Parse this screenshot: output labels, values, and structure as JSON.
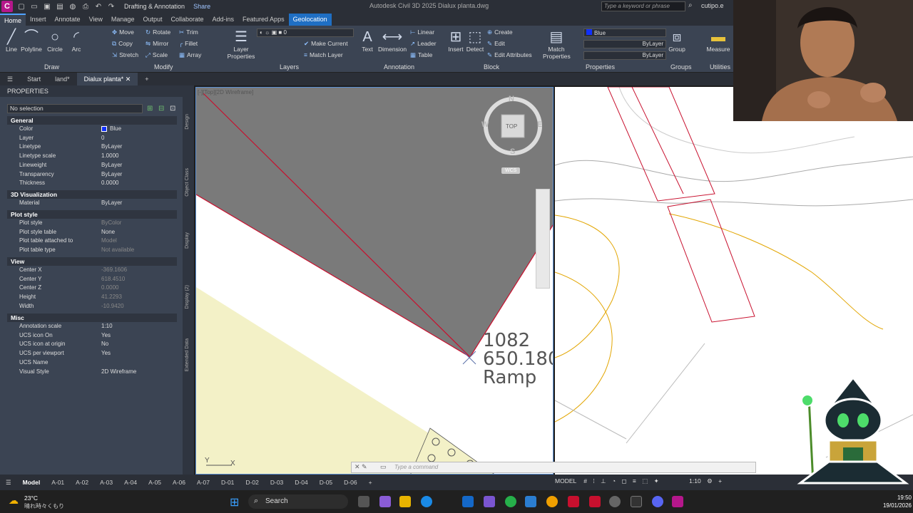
{
  "titlebar": {
    "app_letter": "C",
    "workspace": "Drafting & Annotation",
    "share": "Share",
    "title": "Autodesk Civil 3D 2025    Dialux planta.dwg",
    "search_placeholder": "Type a keyword or phrase",
    "user": "cutipo.e"
  },
  "ribbon_tabs": [
    "Home",
    "Insert",
    "Annotate",
    "View",
    "Manage",
    "Output",
    "Collaborate",
    "Add-ins",
    "Featured Apps",
    "Geolocation"
  ],
  "ribbon": {
    "draw": {
      "label": "Draw",
      "line": "Line",
      "polyline": "Polyline",
      "circle": "Circle",
      "arc": "Arc"
    },
    "modify": {
      "label": "Modify",
      "move": "Move",
      "rotate": "Rotate",
      "trim": "Trim",
      "copy": "Copy",
      "mirror": "Mirror",
      "fillet": "Fillet",
      "stretch": "Stretch",
      "scale": "Scale",
      "array": "Array"
    },
    "layers": {
      "label": "Layers",
      "layer_properties": "Layer Properties",
      "current_layer": "0",
      "make_current": "Make Current",
      "match_layer": "Match Layer"
    },
    "annotation": {
      "label": "Annotation",
      "text": "Text",
      "dimension": "Dimension",
      "linear": "Linear",
      "leader": "Leader",
      "table": "Table"
    },
    "block": {
      "label": "Block",
      "insert": "Insert",
      "detect": "Detect",
      "create": "Create",
      "edit": "Edit",
      "edit_attributes": "Edit Attributes"
    },
    "properties": {
      "label": "Properties",
      "match": "Match Properties",
      "color": "Blue",
      "linetype": "ByLayer",
      "lineweight": "ByLayer"
    },
    "groups": {
      "label": "Groups",
      "group": "Group"
    },
    "utilities": {
      "label": "Utilities",
      "measure": "Measure"
    }
  },
  "file_tabs": [
    "Start",
    "land*",
    "Dialux planta*"
  ],
  "properties_panel": {
    "title": "PROPERTIES",
    "selection": "No selection",
    "sections": {
      "general": "General",
      "viz3d": "3D Visualization",
      "plot": "Plot style",
      "view": "View",
      "misc": "Misc"
    },
    "general": [
      {
        "k": "Color",
        "v": "Blue"
      },
      {
        "k": "Layer",
        "v": "0"
      },
      {
        "k": "Linetype",
        "v": "ByLayer"
      },
      {
        "k": "Linetype scale",
        "v": "1.0000"
      },
      {
        "k": "Lineweight",
        "v": "ByLayer"
      },
      {
        "k": "Transparency",
        "v": "ByLayer"
      },
      {
        "k": "Thickness",
        "v": "0.0000"
      }
    ],
    "viz3d": [
      {
        "k": "Material",
        "v": "ByLayer"
      }
    ],
    "plot": [
      {
        "k": "Plot style",
        "v": "ByColor"
      },
      {
        "k": "Plot style table",
        "v": "None"
      },
      {
        "k": "Plot table attached to",
        "v": "Model"
      },
      {
        "k": "Plot table type",
        "v": "Not available"
      }
    ],
    "view": [
      {
        "k": "Center X",
        "v": "-369.1606"
      },
      {
        "k": "Center Y",
        "v": "618.4510"
      },
      {
        "k": "Center Z",
        "v": "0.0000"
      },
      {
        "k": "Height",
        "v": "41.2293"
      },
      {
        "k": "Width",
        "v": "-10.9420"
      }
    ],
    "misc": [
      {
        "k": "Annotation scale",
        "v": "1:10"
      },
      {
        "k": "UCS icon On",
        "v": "Yes"
      },
      {
        "k": "UCS icon at origin",
        "v": "No"
      },
      {
        "k": "UCS per viewport",
        "v": "Yes"
      },
      {
        "k": "UCS Name",
        "v": ""
      },
      {
        "k": "Visual Style",
        "v": "2D Wireframe"
      }
    ],
    "side_tabs": [
      "Design",
      "Object Class",
      "Display",
      "Display (2)",
      "Extended Data"
    ]
  },
  "viewport": {
    "label": "[-][Top][2D Wireframe]",
    "viewcube": {
      "top": "TOP",
      "n": "N",
      "s": "S",
      "e": "E",
      "w": "W",
      "wcs": "WCS"
    },
    "text1": "1082",
    "text2": "650.180",
    "text3": "Ramp",
    "ucs_y": "Y",
    "ucs_x": "X"
  },
  "command": {
    "placeholder": "Type a command"
  },
  "layout_tabs": [
    "Model",
    "A-01",
    "A-02",
    "A-03",
    "A-04",
    "A-05",
    "A-06",
    "A-07",
    "D-01",
    "D-02",
    "D-03",
    "D-04",
    "D-05",
    "D-06"
  ],
  "status": {
    "model": "MODEL",
    "scale": "1:10"
  },
  "taskbar": {
    "weather_temp": "23°C",
    "weather_desc": "晴れ時々くもり",
    "search": "Search",
    "time": "19:50",
    "date": "19/01/2026"
  },
  "colors": {
    "accent": "#1f6fc4",
    "ribbon": "#3b4453",
    "bar": "#2b2f37",
    "red_line": "#c8102e"
  }
}
